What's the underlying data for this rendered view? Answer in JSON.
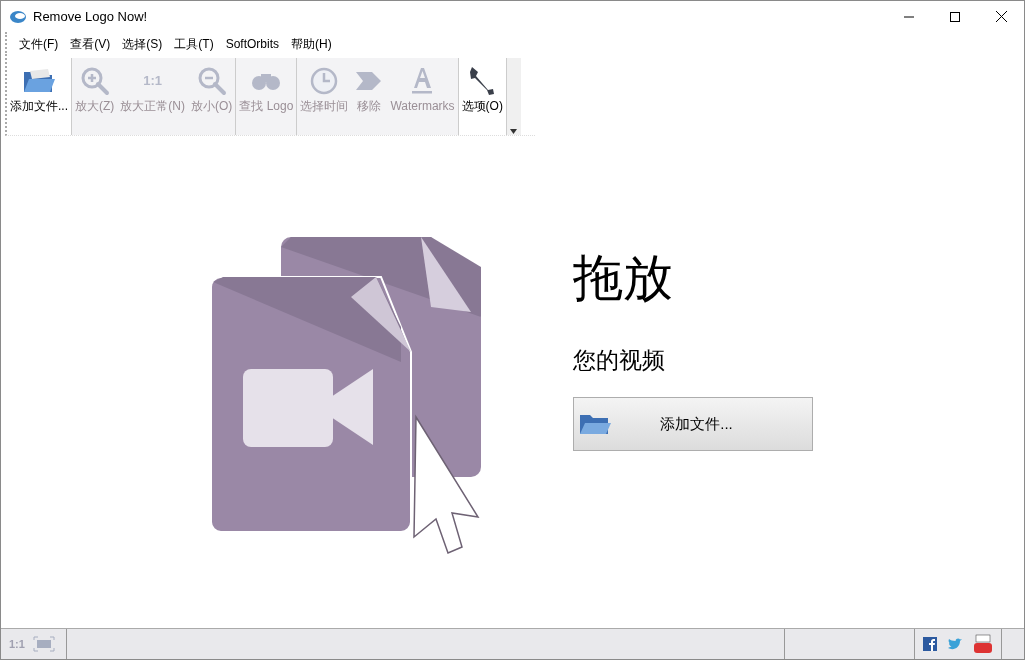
{
  "window": {
    "title": "Remove Logo Now!"
  },
  "menu": [
    "文件(F)",
    "查看(V)",
    "选择(S)",
    "工具(T)",
    "SoftOrbits",
    "帮助(H)"
  ],
  "toolbar": [
    [
      {
        "kind": "open",
        "label": "添加文件...",
        "disabled": false
      }
    ],
    [
      {
        "kind": "zoom-in",
        "label": "放大(Z)",
        "disabled": true
      },
      {
        "kind": "ratio",
        "icon_text": "1:1",
        "label": "放大正常(N)",
        "disabled": true
      },
      {
        "kind": "zoom-out",
        "label": "放小(O)",
        "disabled": true
      }
    ],
    [
      {
        "kind": "find",
        "label": "查找 Logo",
        "disabled": true
      }
    ],
    [
      {
        "kind": "clock",
        "label": "选择时间",
        "disabled": true
      },
      {
        "kind": "remove",
        "label": "移除",
        "disabled": true
      },
      {
        "kind": "watermark",
        "label": "Watermarks",
        "disabled": true
      }
    ],
    [
      {
        "kind": "options",
        "label": "选项(O)",
        "disabled": false
      }
    ]
  ],
  "drop": {
    "title": "拖放",
    "subtitle": "您的视频",
    "button": "添加文件..."
  },
  "status_bar": {
    "zoom": "1:1"
  }
}
